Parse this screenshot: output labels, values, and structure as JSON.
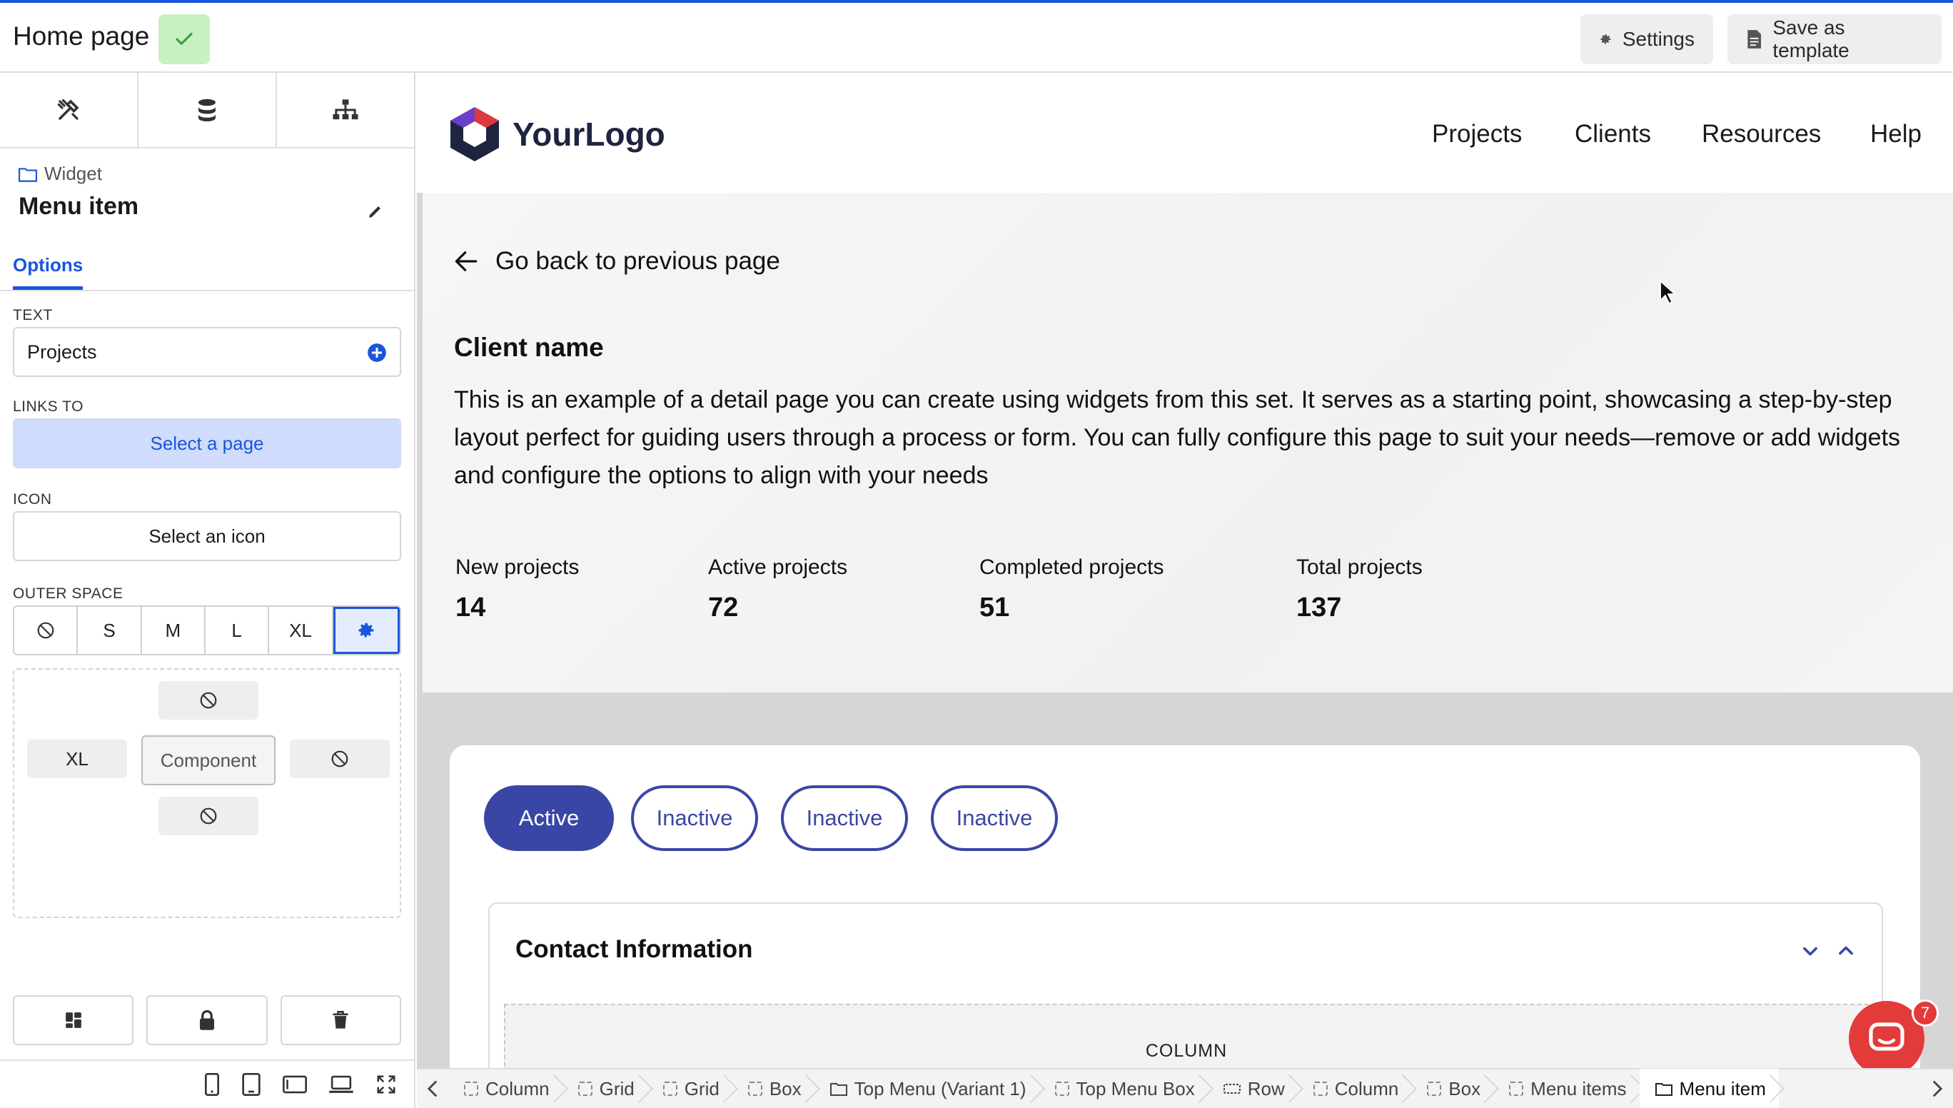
{
  "topbar": {
    "page_title": "Home page",
    "settings_label": "Settings",
    "save_template_label": "Save as template"
  },
  "left_panel": {
    "tool_tabs": [
      "design-tools-icon",
      "database-icon",
      "sitemap-icon"
    ],
    "widget_label": "Widget",
    "widget_title": "Menu item",
    "options_tab": "Options",
    "text_label": "TEXT",
    "text_value": "Projects",
    "links_to_label": "LINKS TO",
    "links_to_button": "Select a page",
    "icon_label": "ICON",
    "icon_button": "Select an icon",
    "outer_space_label": "OUTER SPACE",
    "outer_space_options": [
      "none",
      "S",
      "M",
      "L",
      "XL",
      "custom"
    ],
    "outer_space_selected": "custom",
    "box_model": {
      "top": "none",
      "left": "XL",
      "center": "Component",
      "right": "none",
      "bottom": "none"
    }
  },
  "site": {
    "logo_text": "YourLogo",
    "nav": [
      "Projects",
      "Clients",
      "Resources",
      "Help"
    ],
    "back_link": "Go back to previous page",
    "client_name": "Client name",
    "description": "This is an example of a detail page you can create using widgets from this set. It serves as a starting point, showcasing a step-by-step layout perfect for guiding users through a process or form. You can fully configure this page to suit your needs—remove or add widgets and configure the options to align with your needs",
    "stats": [
      {
        "label": "New projects",
        "value": "14"
      },
      {
        "label": "Active projects",
        "value": "72"
      },
      {
        "label": "Completed projects",
        "value": "51"
      },
      {
        "label": "Total projects",
        "value": "137"
      }
    ],
    "chips": [
      "Active",
      "Inactive",
      "Inactive",
      "Inactive"
    ],
    "contact_title": "Contact Information",
    "column_placeholder": "COLUMN"
  },
  "chat": {
    "badge": "7"
  },
  "breadcrumbs": [
    "Column",
    "Grid",
    "Grid",
    "Box",
    "Top Menu (Variant 1)",
    "Top Menu Box",
    "Row",
    "Column",
    "Box",
    "Menu items",
    "Menu item"
  ],
  "colors": {
    "accent": "#1a56db",
    "chip": "#3a46a6",
    "success_bg": "#c9f0c2",
    "chat": "#e33a3a"
  }
}
